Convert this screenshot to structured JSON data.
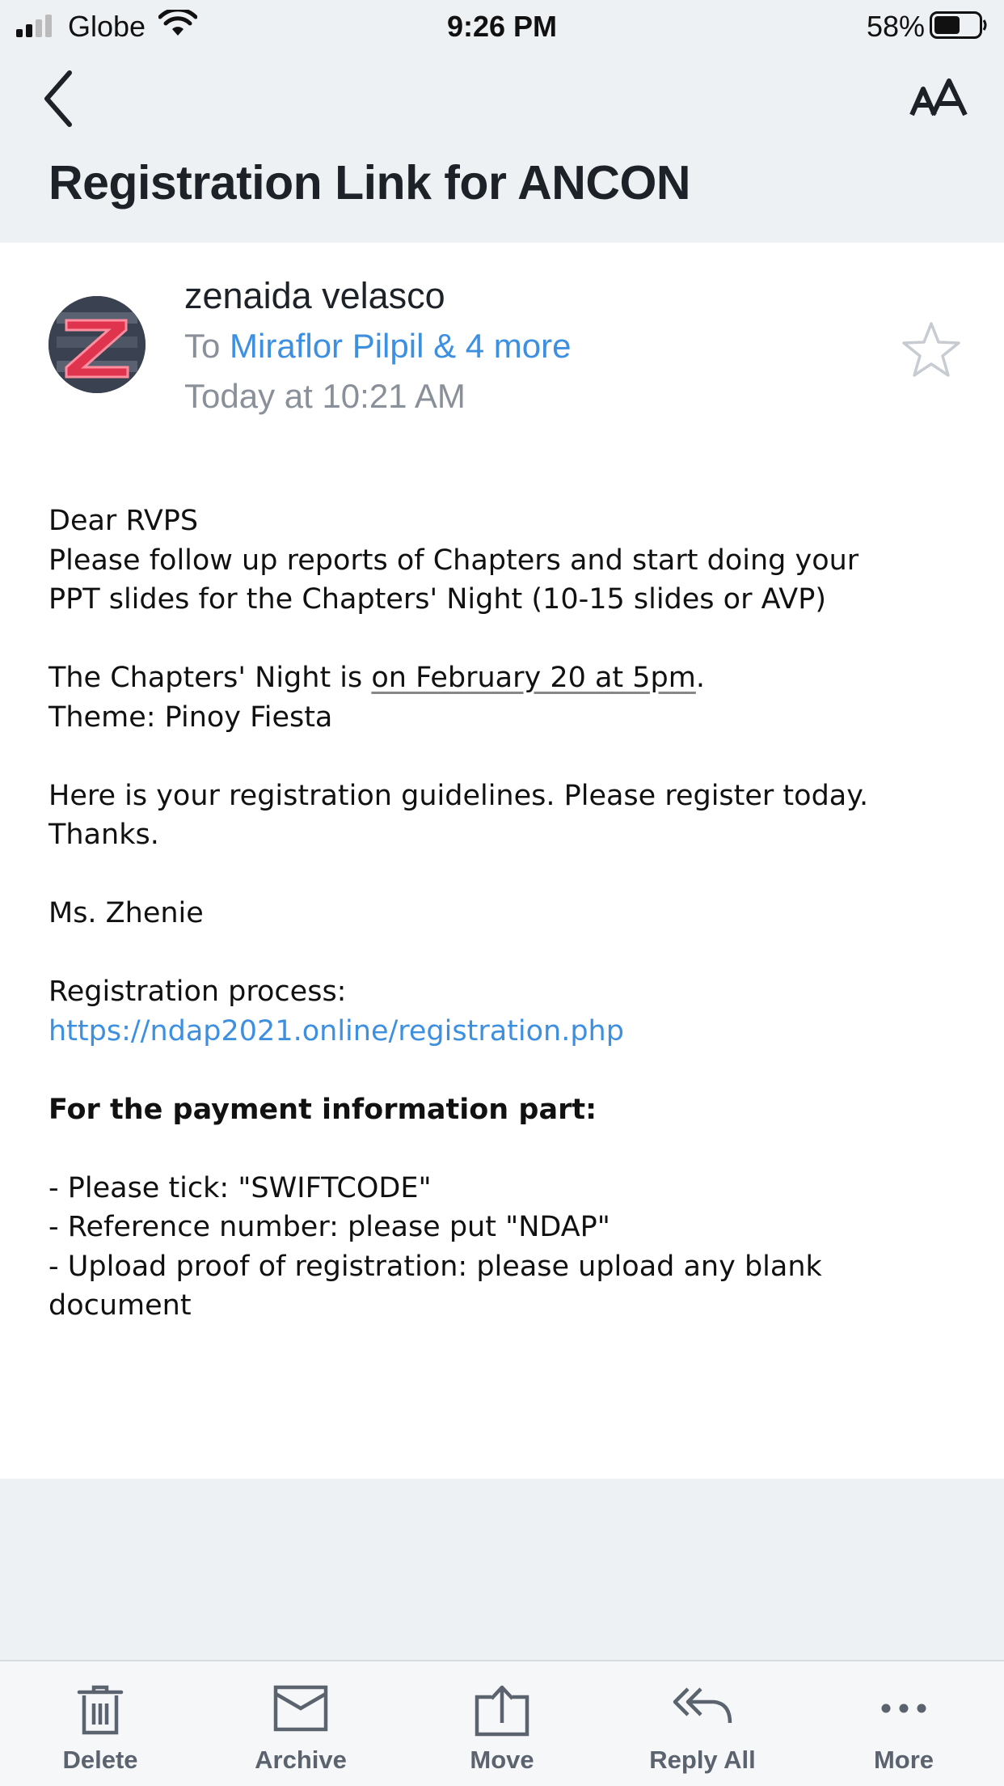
{
  "status_bar": {
    "carrier": "Globe",
    "time": "9:26 PM",
    "battery_percent": "58%",
    "battery_level": 0.58
  },
  "header": {
    "back_icon": "chevron-left-icon",
    "text_size_icon": "text-size-icon",
    "subject": "Registration Link for ANCON"
  },
  "message": {
    "sender_name": "zenaida velasco",
    "to_prefix": "To",
    "to_recipients": "Miraflor Pilpil & 4 more",
    "timestamp": "Today at 10:21 AM",
    "star_icon": "star-outline-icon",
    "body": {
      "greeting": "Dear RVPS",
      "line1": "Please follow up reports of Chapters and start doing your",
      "line2": "PPT slides for the Chapters' Night (10-15 slides or AVP)",
      "night_prefix": "The Chapters' Night is ",
      "night_date": "on February 20 at 5pm",
      "night_suffix": ".",
      "theme": "Theme: Pinoy Fiesta",
      "guidelines": "Here is your registration guidelines. Please register today.",
      "thanks": "Thanks.",
      "signature": "Ms. Zhenie",
      "process_label": "Registration process:",
      "process_link": "https://ndap2021.online/registration.php",
      "payment_heading": "For the payment information part:",
      "bullet1": "- Please tick: \"SWIFTCODE\"",
      "bullet2": "- Reference number: please put \"NDAP\"",
      "bullet3a": "- Upload proof of registration: please upload any blank",
      "bullet3b": "document"
    }
  },
  "toolbar": {
    "delete": "Delete",
    "archive": "Archive",
    "move": "Move",
    "reply_all": "Reply All",
    "more": "More"
  },
  "colors": {
    "accent": "#3d8fe0",
    "header_bg": "#eef1f4",
    "toolbar_icon": "#5b636e"
  }
}
